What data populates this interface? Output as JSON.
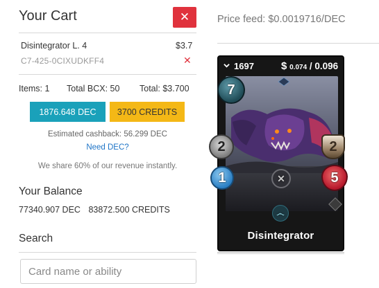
{
  "cart": {
    "title": "Your Cart",
    "close_glyph": "✕",
    "item": {
      "name": "Disintegrator L. 4",
      "price": "$3.7",
      "id": "C7-425-0CIXUDKFF4",
      "remove_glyph": "✕"
    },
    "totals": {
      "items": "Items: 1",
      "bcx": "Total BCX: 50",
      "total": "Total: $3.700"
    },
    "pay_dec_label": "1876.648 DEC",
    "pay_credits_label": "3700 CREDITS",
    "cashback": "Estimated cashback: 56.299 DEC",
    "need_dec": "Need DEC?",
    "revenue_note": "We share 60% of our revenue instantly.",
    "balance": {
      "title": "Your Balance",
      "dec": "77340.907 DEC",
      "credits": "83872.500 CREDITS"
    },
    "search": {
      "title": "Search",
      "placeholder": "Card name or ability"
    }
  },
  "price_feed": "Price feed: $0.0019716/DEC",
  "card": {
    "count": "1697",
    "price_symbol": "$",
    "price_low": "0.074",
    "price_sep": " / ",
    "price_high": "0.096",
    "mana": "7",
    "melee": "2",
    "armor": "2",
    "speed": "1",
    "health": "5",
    "name": "Disintegrator",
    "icons": [
      "chevron-down-icon",
      "dollar-icon",
      "mana-icon",
      "melee-attack-icon",
      "armor-icon",
      "speed-icon",
      "health-icon",
      "ability-icon",
      "element-icon"
    ]
  },
  "colors": {
    "close_red": "#e0323d",
    "dec_teal": "#1aa1ba",
    "credits_yellow": "#f4b816",
    "link_blue": "#1e74c7"
  }
}
